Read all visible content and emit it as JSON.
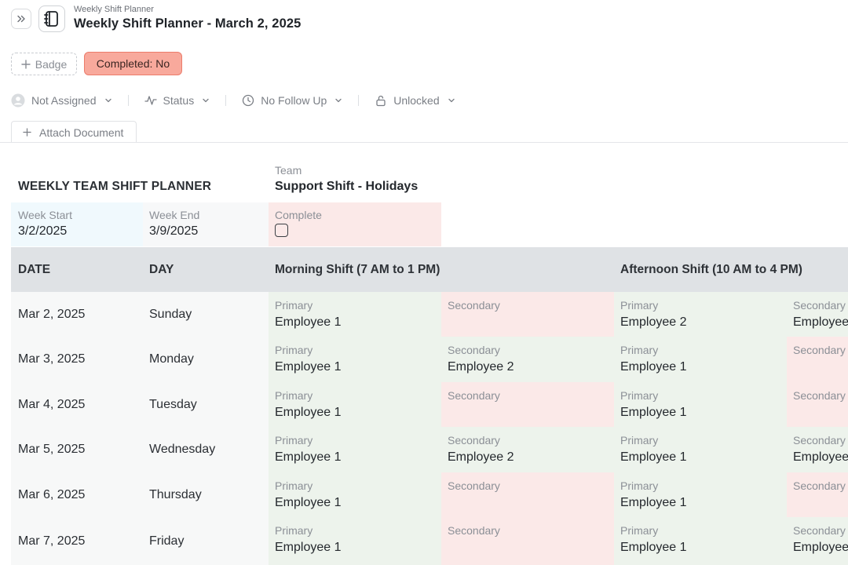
{
  "header": {
    "breadcrumb": "Weekly Shift Planner",
    "title": "Weekly Shift Planner - March 2, 2025"
  },
  "badges": {
    "add_label": "Badge",
    "completed_label": "Completed: No",
    "completed_color": "#f8a99c"
  },
  "properties": {
    "assignee": "Not Assigned",
    "status": "Status",
    "follow_up": "No Follow Up",
    "lock": "Unlocked"
  },
  "attach": {
    "label": "Attach Document"
  },
  "document": {
    "title": "WEEKLY TEAM SHIFT PLANNER",
    "team_label": "Team",
    "team_value": "Support Shift - Holidays",
    "week_start_label": "Week Start",
    "week_start_value": "3/2/2025",
    "week_end_label": "Week End",
    "week_end_value": "3/9/2025",
    "complete_label": "Complete",
    "complete_checked": false
  },
  "table": {
    "headers": {
      "date": "DATE",
      "day": "DAY",
      "morning": "Morning Shift (7 AM to 1 PM)",
      "afternoon": "Afternoon Shift (10 AM to 4 PM)"
    },
    "primary_label": "Primary",
    "secondary_label": "Secondary",
    "rows": [
      {
        "date": "Mar 2, 2025",
        "day": "Sunday",
        "m_pri": "Employee 1",
        "m_sec": "",
        "a_pri": "Employee 2",
        "a_sec": "Employee"
      },
      {
        "date": "Mar 3, 2025",
        "day": "Monday",
        "m_pri": "Employee 1",
        "m_sec": "Employee 2",
        "a_pri": "Employee 1",
        "a_sec": ""
      },
      {
        "date": "Mar 4, 2025",
        "day": "Tuesday",
        "m_pri": "Employee 1",
        "m_sec": "",
        "a_pri": "Employee 1",
        "a_sec": ""
      },
      {
        "date": "Mar 5, 2025",
        "day": "Wednesday",
        "m_pri": "Employee 1",
        "m_sec": "Employee 2",
        "a_pri": "Employee 1",
        "a_sec": "Employee"
      },
      {
        "date": "Mar 6, 2025",
        "day": "Thursday",
        "m_pri": "Employee 1",
        "m_sec": "",
        "a_pri": "Employee 1",
        "a_sec": ""
      },
      {
        "date": "Mar 7, 2025",
        "day": "Friday",
        "m_pri": "Employee 1",
        "m_sec": "",
        "a_pri": "Employee 1",
        "a_sec": "Employee"
      }
    ]
  },
  "colors": {
    "filled_cell": "#edf3ec",
    "empty_cell": "#fbe9e8",
    "header_bg": "#dfe2e5",
    "week_start_bg": "#f0f9fd"
  },
  "icons": {
    "expand": "double-chevron-right-icon",
    "app": "notebook-icon",
    "add": "plus-icon",
    "assignee": "user-avatar-icon",
    "status": "activity-icon",
    "follow_up": "clock-icon",
    "lock": "unlock-icon",
    "dropdown": "chevron-down-icon"
  }
}
